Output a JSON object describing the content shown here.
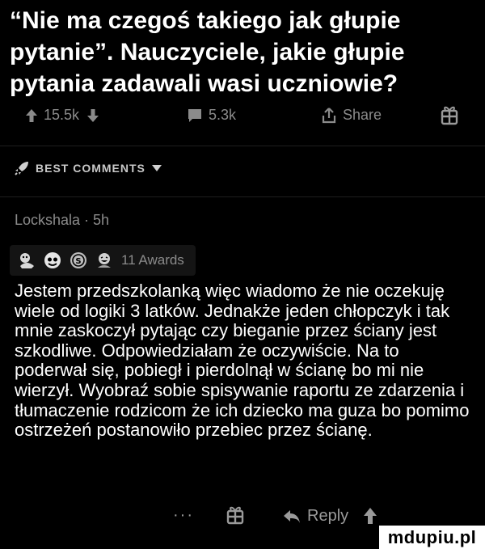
{
  "post": {
    "title": "“Nie ma czegoś takiego jak głupie pytanie”. Nauczyciele, jakie głupie pytania zadawali wasi uczniowie?"
  },
  "actions": {
    "upvotes": "15.5k",
    "comments": "5.3k",
    "share_label": "Share"
  },
  "comments_header": {
    "label": "BEST COMMENTS"
  },
  "comment": {
    "author_line": "Lockshala · 5h",
    "awards_label": "11 Awards",
    "body": "Jestem przedszkolanką więc wiadomo że nie oczekuję wiele od logiki 3 latków. Jednakże jeden chłopczyk i tak mnie zaskoczył pytając czy bieganie przez ściany jest szkodliwe. Odpowiedziałam że oczywiście. Na to poderwał się, pobiegł i pierdolnął w ścianę bo mi nie wierzył. Wyobraź sobie spisywanie raportu ze zdarzenia i tłumaczenie rodzicom że ich dziecko ma guza bo pomimo ostrzeżeń postanowiło przebiec przez ścianę.",
    "more_label": "···",
    "reply_label": "Reply"
  },
  "watermark": {
    "text": "mdupiu.pl"
  }
}
